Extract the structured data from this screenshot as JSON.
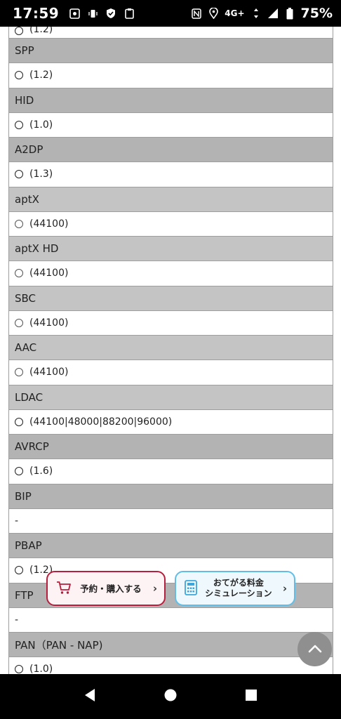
{
  "status_bar": {
    "time": "17:59",
    "network": "4G+",
    "battery": "75%",
    "icons_left": [
      "screenshot-icon",
      "vibrate-icon",
      "shield-icon",
      "clipboard-icon"
    ],
    "icons_right": [
      "nfc-icon",
      "location-icon",
      "data-arrows-icon",
      "signal-icon",
      "battery-icon"
    ]
  },
  "spec_list": {
    "top_partial_value": "(1.2)",
    "rows": [
      {
        "label": "SPP",
        "value": "(1.2)"
      },
      {
        "label": "HID",
        "value": "(1.0)"
      },
      {
        "label": "A2DP",
        "value": "(1.3)"
      },
      {
        "label": "aptX",
        "value": "(44100)"
      },
      {
        "label": "aptX HD",
        "value": "(44100)"
      },
      {
        "label": "SBC",
        "value": "(44100)"
      },
      {
        "label": "AAC",
        "value": "(44100)"
      },
      {
        "label": "LDAC",
        "value": "(44100|48000|88200|96000)"
      },
      {
        "label": "AVRCP",
        "value": "(1.6)"
      },
      {
        "label": "BIP",
        "value": "-"
      },
      {
        "label": "PBAP",
        "value": "(1.2)"
      },
      {
        "label": "FTP",
        "value": "-"
      },
      {
        "label": "PAN（PAN - NAP)",
        "value": "(1.0)"
      }
    ]
  },
  "floating": {
    "reserve_label": "予約・購入する",
    "sim_line1": "おてがる料金",
    "sim_line2": "シミュレーション",
    "accent_reserve": "#b51f3d",
    "accent_sim": "#62bde6"
  },
  "nav": {
    "back": "back-icon",
    "home": "home-icon",
    "recents": "recents-icon"
  }
}
